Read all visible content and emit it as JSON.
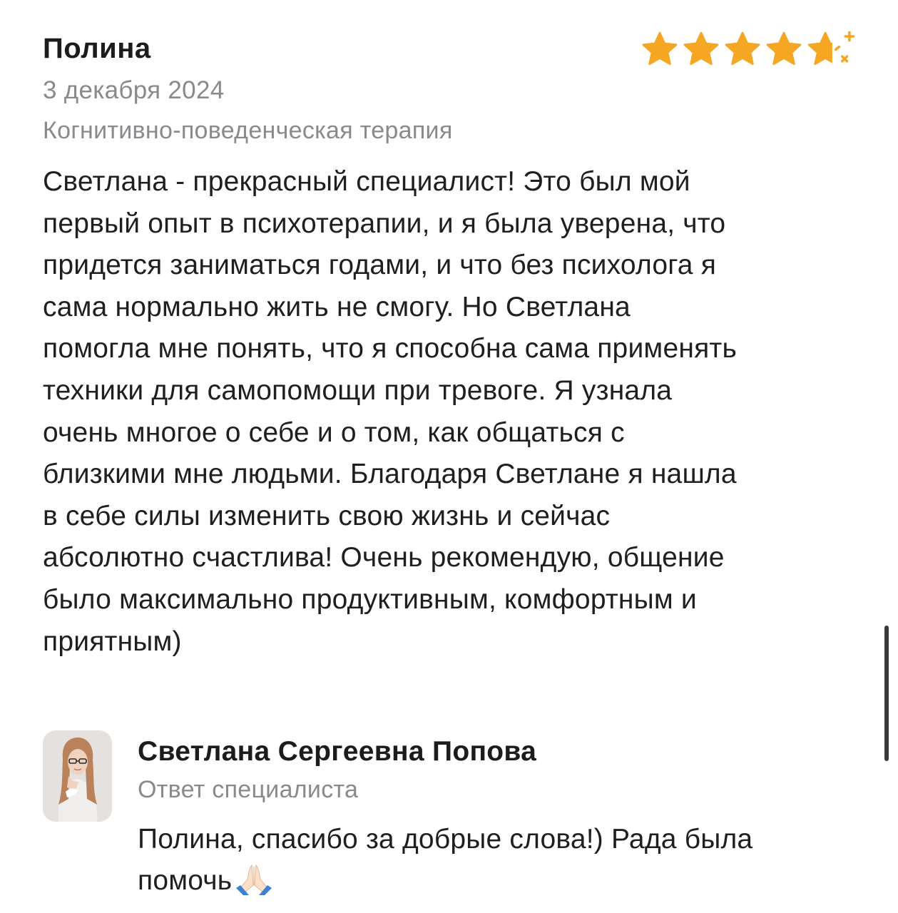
{
  "review": {
    "author": "Полина",
    "date": "3 декабря 2024",
    "method": "Когнитивно-поведенческая терапия",
    "rating": 4.5,
    "rating_max": 5,
    "star_color": "#f5a623",
    "text": "Светлана - прекрасный специалист! Это был мой\nпервый опыт в психотерапии, и я была уверена, что\nпридется заниматься годами, и что без психолога я\nсама нормально жить не смогу. Но Светлана\nпомогла мне понять, что я способна сама применять\nтехники для самопомощи при тревоге. Я узнала\nочень многое о себе и о том, как общаться с\nблизкими мне людьми. Благодаря Светлане я нашла\nв себе силы изменить свою жизнь и сейчас\nабсолютно счастлива! Очень рекомендую, общение\nбыло максимально продуктивным, комфортным и\nприятным)"
  },
  "reply": {
    "author": "Светлана Сергеевна Попова",
    "label": "Ответ специалиста",
    "text": "Полина, спасибо за добрые слова!) Рада была\nпомочь",
    "emoji": "folded-hands-icon"
  },
  "colors": {
    "text": "#1f1f1f",
    "secondary": "#8a8a8e",
    "star": "#f5a623"
  }
}
